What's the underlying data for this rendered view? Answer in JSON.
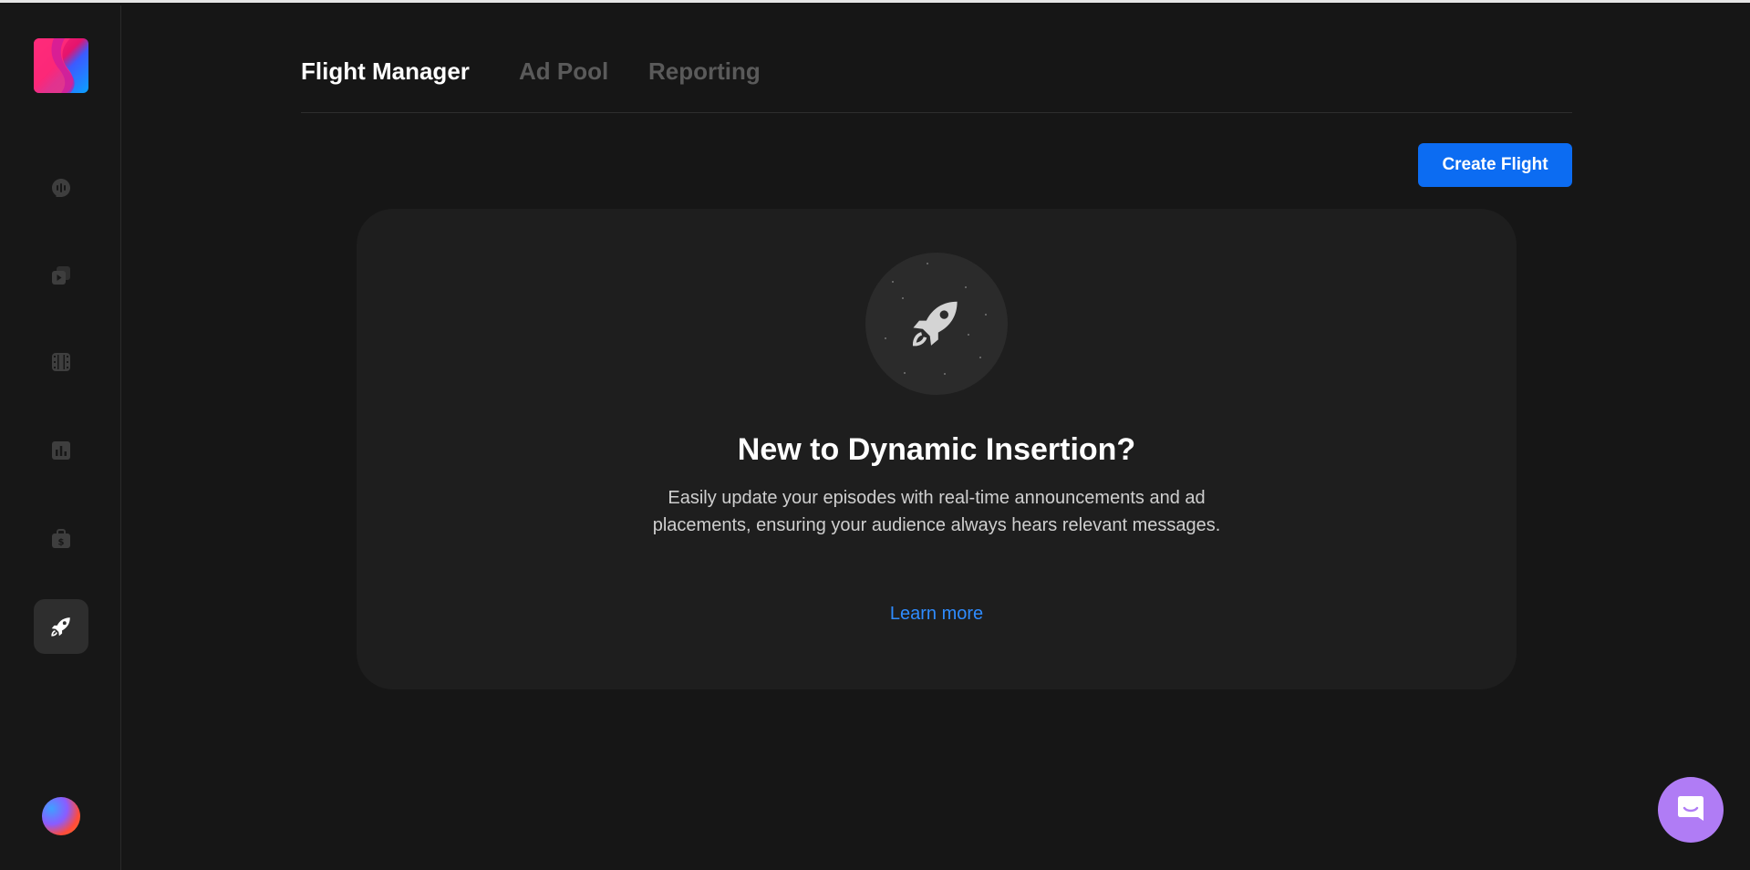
{
  "app": {
    "brand_colors": {
      "accent": "#0c6cf2",
      "link": "#2f8cff",
      "chat_bubble": "#b07cf5"
    }
  },
  "sidebar": {
    "logo_icon": "brand-logo-icon",
    "items": [
      {
        "icon": "podcast-icon",
        "active": false
      },
      {
        "icon": "episodes-icon",
        "active": false
      },
      {
        "icon": "video-icon",
        "active": false
      },
      {
        "icon": "analytics-icon",
        "active": false
      },
      {
        "icon": "monetization-icon",
        "active": false
      },
      {
        "icon": "rocket-icon",
        "active": true
      }
    ],
    "avatar_icon": "user-avatar"
  },
  "tabs": [
    {
      "label": "Flight Manager",
      "active": true
    },
    {
      "label": "Ad Pool",
      "active": false
    },
    {
      "label": "Reporting",
      "active": false
    }
  ],
  "toolbar": {
    "create_label": "Create Flight"
  },
  "empty_state": {
    "icon": "rocket-icon",
    "title": "New to Dynamic Insertion?",
    "description": "Easily update your episodes with real-time announcements and ad placements, ensuring your audience always hears relevant messages.",
    "link_label": "Learn more"
  },
  "chat": {
    "icon": "chat-icon"
  }
}
